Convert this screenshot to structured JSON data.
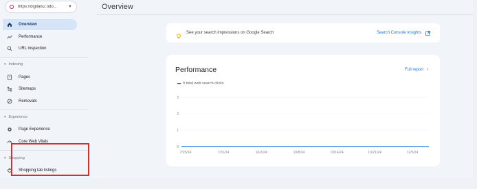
{
  "property": {
    "url": "https://digitals2.odo...",
    "caret": "▼"
  },
  "nav": {
    "top_items": [
      {
        "label": "Overview",
        "icon": "home-icon"
      },
      {
        "label": "Performance",
        "icon": "trending-up-icon"
      },
      {
        "label": "URL inspection",
        "icon": "search-icon"
      }
    ],
    "indexing": {
      "heading": "Indexing",
      "items": [
        {
          "label": "Pages",
          "icon": "pages-icon"
        },
        {
          "label": "Sitemaps",
          "icon": "sitemap-icon"
        },
        {
          "label": "Removals",
          "icon": "removals-icon"
        }
      ]
    },
    "experience": {
      "heading": "Experience",
      "items": [
        {
          "label": "Page Experience",
          "icon": "page-experience-icon"
        },
        {
          "label": "Core Web Vitals",
          "icon": "gauge-icon"
        }
      ]
    },
    "shopping": {
      "heading": "Shopping",
      "items": [
        {
          "label": "Shopping tab listings",
          "icon": "tag-icon"
        }
      ]
    }
  },
  "header": {
    "title": "Overview"
  },
  "banner": {
    "message": "See your search impressions on Google Search",
    "link": "Search Console Insights"
  },
  "performance": {
    "title": "Performance",
    "full_report": "Full report",
    "legend": "0 total web search clicks"
  },
  "colors": {
    "accent": "#1a73e8",
    "active_nav_bg": "#d6e4f7",
    "highlight": "#d32f2f"
  },
  "chart_data": {
    "type": "line",
    "x": [
      "7/25/24",
      "7/31/24",
      "10/2/24",
      "10/8/24",
      "10/14/24",
      "10/21/24",
      "12/5/24"
    ],
    "series": [
      {
        "name": "total web search clicks",
        "values": [
          0,
          0,
          0,
          0,
          0,
          0,
          0
        ]
      }
    ],
    "yticks": [
      "3",
      "2",
      "1",
      "0"
    ],
    "ylim": [
      0,
      3
    ],
    "grid": true,
    "legend_position": "top-left"
  }
}
